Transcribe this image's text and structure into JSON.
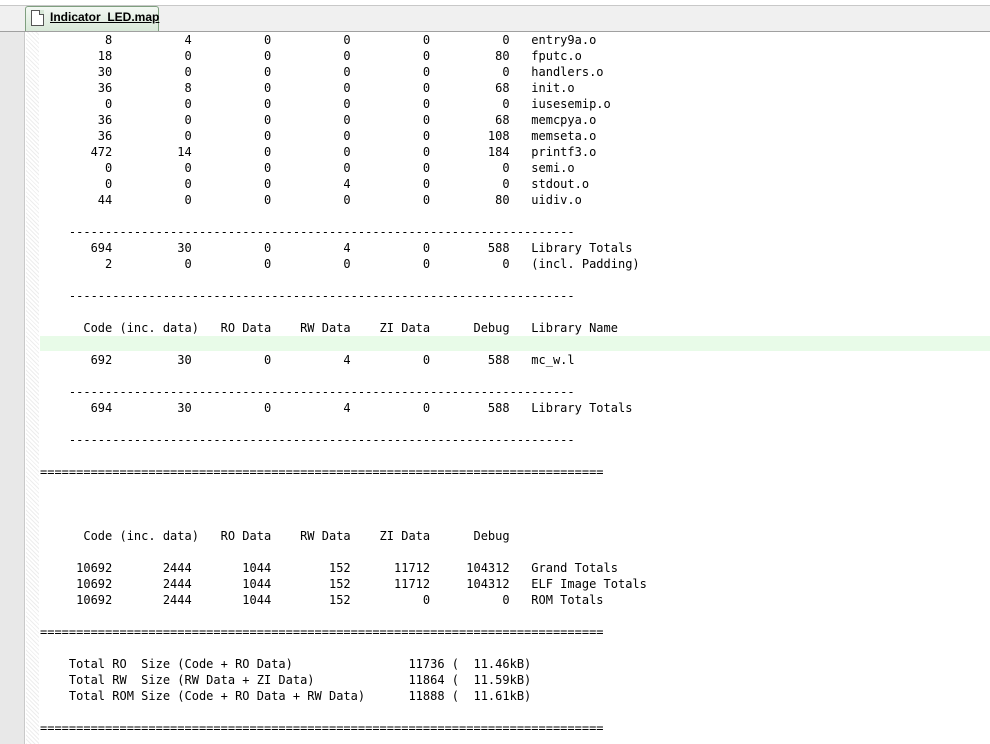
{
  "tab": {
    "title": "Indicator_LED.map"
  },
  "editor": {
    "lines": [
      "         8          4          0          0          0          0   entry9a.o",
      "        18          0          0          0          0         80   fputc.o",
      "        30          0          0          0          0          0   handlers.o",
      "        36          8          0          0          0         68   init.o",
      "         0          0          0          0          0          0   iusesemip.o",
      "        36          0          0          0          0         68   memcpya.o",
      "        36          0          0          0          0        108   memseta.o",
      "       472         14          0          0          0        184   printf3.o",
      "         0          0          0          0          0          0   semi.o",
      "         0          0          0          4          0          0   stdout.o",
      "        44          0          0          0          0         80   uidiv.o",
      "",
      "    ----------------------------------------------------------------------",
      "       694         30          0          4          0        588   Library Totals",
      "         2          0          0          0          0          0   (incl. Padding)",
      "",
      "    ----------------------------------------------------------------------",
      "",
      "      Code (inc. data)   RO Data    RW Data    ZI Data      Debug   Library Name",
      "",
      "       692         30          0          4          0        588   mc_w.l",
      "",
      "    ----------------------------------------------------------------------",
      "       694         30          0          4          0        588   Library Totals",
      "",
      "    ----------------------------------------------------------------------",
      "",
      "==============================================================================",
      "",
      "",
      "",
      "      Code (inc. data)   RO Data    RW Data    ZI Data      Debug   ",
      "",
      "     10692       2444       1044        152      11712     104312   Grand Totals",
      "     10692       2444       1044        152      11712     104312   ELF Image Totals",
      "     10692       2444       1044        152          0          0   ROM Totals",
      "",
      "==============================================================================",
      "",
      "    Total RO  Size (Code + RO Data)                11736 (  11.46kB)",
      "    Total RW  Size (RW Data + ZI Data)             11864 (  11.59kB)",
      "    Total ROM Size (Code + RO Data + RW Data)      11888 (  11.61kB)",
      "",
      "=============================================================================="
    ]
  }
}
